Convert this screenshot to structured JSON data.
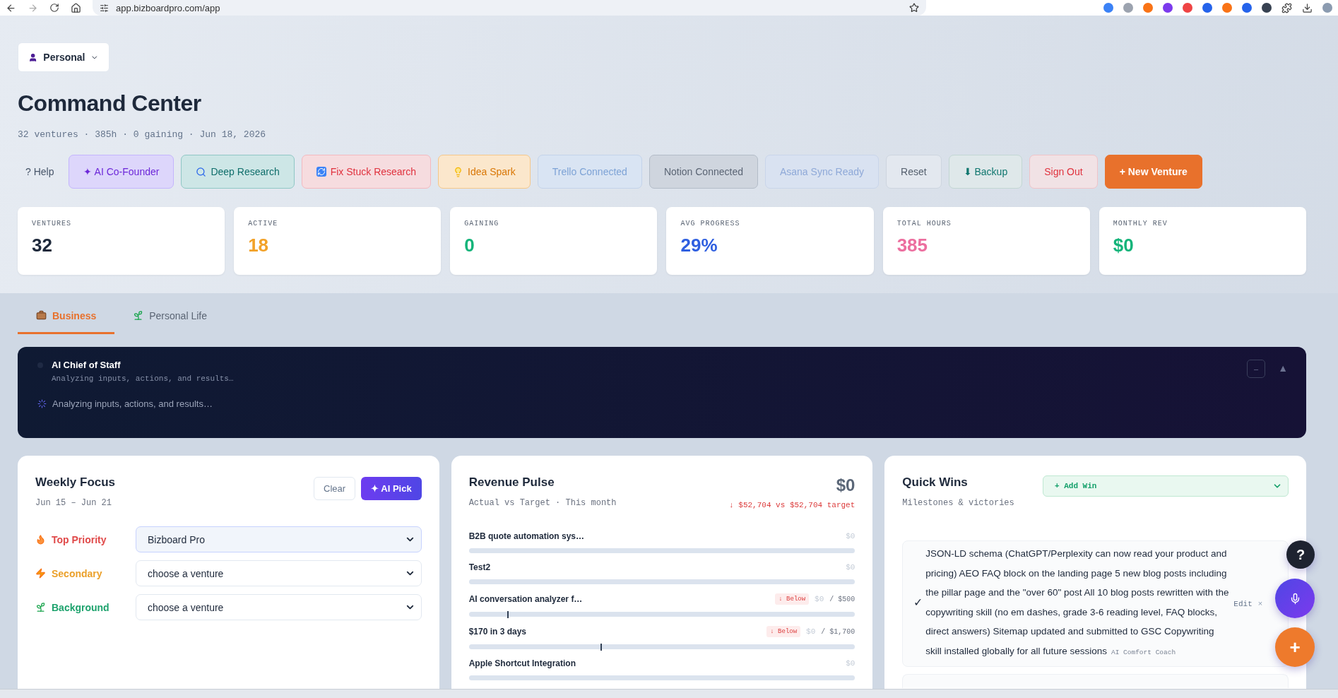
{
  "browser": {
    "url": "app.bizboardpro.com/app"
  },
  "profile": {
    "label": "Personal"
  },
  "title": "Command Center",
  "subtitle": "32 ventures · 385h · 0 gaining · Jun 18, 2026",
  "actions": [
    {
      "label": "? Help",
      "kind": "help"
    },
    {
      "label": "✦ AI Co-Founder",
      "kind": "cofounder"
    },
    {
      "label": "Deep Research",
      "kind": "research"
    },
    {
      "label": "Fix Stuck Research",
      "kind": "fix"
    },
    {
      "label": "Idea Spark",
      "kind": "idea"
    },
    {
      "label": "Trello Connected",
      "kind": "trello"
    },
    {
      "label": "Notion Connected",
      "kind": "notion"
    },
    {
      "label": "Asana Sync Ready",
      "kind": "asana"
    },
    {
      "label": "Reset",
      "kind": "reset"
    },
    {
      "label": "⬇ Backup",
      "kind": "backup"
    },
    {
      "label": "Sign Out",
      "kind": "signout"
    },
    {
      "label": "+ New Venture",
      "kind": "new"
    }
  ],
  "stats": [
    {
      "label": "VENTURES",
      "value": "32",
      "color": "#1e293b"
    },
    {
      "label": "ACTIVE",
      "value": "18",
      "color": "#f2a229"
    },
    {
      "label": "GAINING",
      "value": "0",
      "color": "#14b47a"
    },
    {
      "label": "AVG PROGRESS",
      "value": "29%",
      "color": "#2f5fe0"
    },
    {
      "label": "TOTAL HOURS",
      "value": "385",
      "color": "#ec6f9f"
    },
    {
      "label": "MONTHLY REV",
      "value": "$0",
      "color": "#14b47a"
    }
  ],
  "tabs": [
    {
      "label": "Business",
      "kind": "business",
      "selected": true
    },
    {
      "label": "Personal Life",
      "kind": "personal",
      "selected": false
    }
  ],
  "chief": {
    "title": "AI Chief of Staff",
    "subtitle": "Analyzing inputs, actions, and results…",
    "status": "Analyzing inputs, actions, and results…",
    "minimize": "–",
    "collapse": "▲"
  },
  "weekly": {
    "title": "Weekly Focus",
    "dates": "Jun 15 – Jun 21",
    "clear": "Clear",
    "ai_pick": "✦ AI Pick",
    "rows": [
      {
        "kind": "top",
        "label": "Top Priority",
        "color": "#e04a4a",
        "value": "Bizboard Pro",
        "chosen": true
      },
      {
        "kind": "secondary",
        "label": "Secondary",
        "color": "#eba02a",
        "value": "choose a venture",
        "chosen": false
      },
      {
        "kind": "background",
        "label": "Background",
        "color": "#1fa36e",
        "value": "choose a venture",
        "chosen": false
      }
    ]
  },
  "revenue": {
    "title": "Revenue Pulse",
    "subtitle": "Actual vs Target · This month",
    "total": "$0",
    "delta": "↓ $52,704 vs $52,704 target",
    "rows": [
      {
        "name": "B2B quote automation sys…",
        "amount": "$0"
      },
      {
        "name": "Test2",
        "amount": "$0"
      },
      {
        "name": "AI conversation analyzer f…",
        "badge": "↓ Below",
        "amount": "$0",
        "target": "/ $500",
        "level": 0.1
      },
      {
        "name": "$170 in 3 days",
        "badge": "↓ Below",
        "amount": "$0",
        "target": "/ $1,700",
        "level": 0.34
      },
      {
        "name": "Apple Shortcut Integration",
        "amount": "$0"
      }
    ]
  },
  "wins": {
    "title": "Quick Wins",
    "subtitle": "Milestones & victories",
    "add": "+ Add Win",
    "items": [
      {
        "text": "JSON-LD schema (ChatGPT/Perplexity can now read your product and pricing) AEO FAQ block on the landing page 5 new blog posts including the pillar page and the \"over 60\" post All 10 blog posts rewritten with the copywriting skill (no em dashes, grade 3-6 reading level, FAQ blocks, direct answers) Sitemap updated and submitted to GSC Copywriting skill installed globally for all future sessions",
        "tag": "AI Comfort Coach",
        "done": true,
        "check": "✓",
        "edit": "Edit",
        "remove": "×"
      }
    ]
  },
  "fab": {
    "help": "?",
    "add": "+"
  }
}
